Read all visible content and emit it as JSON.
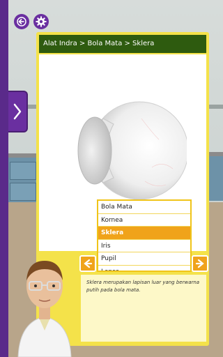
{
  "header": {
    "breadcrumb": "Alat Indra > Bola Mata > Sklera"
  },
  "icons": {
    "back": "back-arrow-icon",
    "settings": "gear-icon",
    "side_toggle": "chevron-right-icon",
    "prev": "arrow-left-icon",
    "next": "arrow-right-icon"
  },
  "part_list": {
    "items": [
      "Bola Mata",
      "Kornea",
      "Sklera",
      "Iris",
      "Pupil",
      "Lensa"
    ],
    "selected_index": 2
  },
  "description": {
    "text": "Sklera merupakan lapisan luar yang berwarna putih pada bola mata."
  },
  "colors": {
    "purple": "#6a2fa0",
    "breadcrumb_bg": "#2e5b0f",
    "panel_yellow": "#f4e24a",
    "selected_orange": "#f0a31a"
  }
}
